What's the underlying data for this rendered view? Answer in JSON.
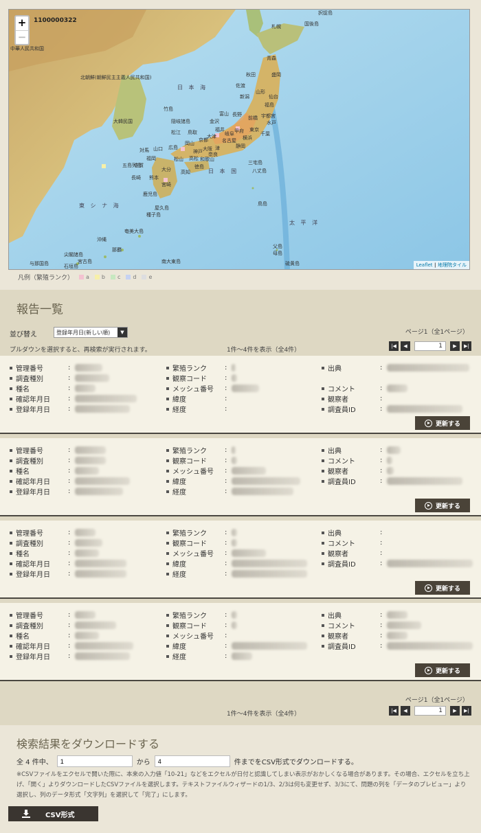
{
  "map": {
    "id_label": "1100000322",
    "zoom_in": "+",
    "zoom_out": "−",
    "labels": {
      "china": "中華人民共和国",
      "north_korea": "北朝鮮(朝鮮民主主義人民共和国)",
      "south_korea": "大韓民国",
      "sea_of_japan": "日 本 海",
      "east_china_sea": "東 シ ナ 海",
      "pacific": "太 平 洋",
      "japan": "日 本 国",
      "sapporo": "札幌",
      "aomori": "青森",
      "akita": "秋田",
      "morioka": "盛岡",
      "sendai": "仙台",
      "yamagata": "山形",
      "niigata": "新潟",
      "fukushima": "福島",
      "kanazawa": "金沢",
      "toyama": "富山",
      "nagano": "長野",
      "maebashi": "前橋",
      "utsunomiya": "宇都宮",
      "mito": "水戸",
      "tokyo": "東京",
      "chiba": "千葉",
      "yokohama": "横浜",
      "kofu": "甲府",
      "shizuoka": "静岡",
      "nagoya": "名古屋",
      "gifu": "岐阜",
      "fukui": "福井",
      "tsu": "津",
      "otsu": "大津",
      "kyoto": "京都",
      "osaka": "大阪",
      "kobe": "神戸",
      "nara": "奈良",
      "wakayama": "和歌山",
      "tottori": "鳥取",
      "matsue": "松江",
      "okayama": "岡山",
      "hiroshima": "広島",
      "yamaguchi": "山口",
      "takamatsu": "高松",
      "tokushima": "徳島",
      "matsuyama": "松山",
      "kochi": "高知",
      "fukuoka": "福岡",
      "saga": "佐賀",
      "nagasaki": "長崎",
      "kumamoto": "熊本",
      "oita": "大分",
      "miyazaki": "宮崎",
      "kagoshima": "鹿児島",
      "naha": "那覇",
      "takeshima": "竹島",
      "oki": "隠岐諸島",
      "tsushima": "対馬",
      "goto": "五島列島",
      "hachijo": "八丈島",
      "miyake": "三宅島",
      "tori": "鳥島",
      "ogasawara": "父島",
      "haha": "母島",
      "amami": "奄美大島",
      "yaku": "屋久島",
      "tanega": "種子島",
      "daito": "南大東島",
      "ishigaki": "石垣島",
      "miyako": "宮古島",
      "yonaguni": "与那国島",
      "sado": "佐渡",
      "etorofu": "択捉島",
      "kunashiri": "国後島",
      "senkaku": "尖閣諸島",
      "okino": "沖縄",
      "io": "硫黄島"
    },
    "attribution_leaflet": "Leaflet",
    "attribution_sep": " | ",
    "attribution_tile": "地理院タイル"
  },
  "legend": {
    "title": "凡例（繁殖ランク）",
    "items": [
      {
        "label": "a",
        "color": "#f4c2d0"
      },
      {
        "label": "b",
        "color": "#f7f0a8"
      },
      {
        "label": "c",
        "color": "#c7e8c0"
      },
      {
        "label": "d",
        "color": "#c6d2f2"
      },
      {
        "label": "e",
        "color": "#dddde0"
      }
    ]
  },
  "report": {
    "title": "報告一覧",
    "sort_label": "並び替え",
    "sort_value": "登録年月日(新しい順)",
    "hint": "プルダウンを選択すると、再検索が実行されます。",
    "count_text": "1件～4件を表示（全4件）",
    "page_info": "ページ1（全1ページ）",
    "page_value": "1",
    "update_label": "更新する",
    "col1_labels": [
      "管理番号",
      "調査種別",
      "種名",
      "確認年月日",
      "登録年月日"
    ],
    "col2_labels": [
      "繁殖ランク",
      "観察コード",
      "メッシュ番号",
      "緯度",
      "経度"
    ],
    "cards": [
      {
        "col3": [
          "出典",
          "",
          "コメント",
          "観察者",
          "調査員ID"
        ],
        "col3_colon": [
          true,
          false,
          true,
          true,
          true
        ]
      },
      {
        "col3": [
          "出典",
          "コメント",
          "観察者",
          "調査員ID"
        ],
        "col3_colon": [
          true,
          true,
          true,
          true
        ]
      },
      {
        "col3": [
          "出典",
          "コメント",
          "観察者",
          "調査員ID"
        ],
        "col3_colon": [
          true,
          true,
          true,
          true
        ]
      },
      {
        "col3": [
          "出典",
          "コメント",
          "観察者",
          "調査員ID"
        ],
        "col3_colon": [
          true,
          true,
          true,
          true
        ]
      }
    ]
  },
  "download": {
    "title": "検索結果をダウンロードする",
    "prefix": "全 4 件中、",
    "from_value": "1",
    "middle": "から",
    "to_value": "4",
    "suffix": "件までをCSV形式でダウンロードする。",
    "note": "※CSVファイルをエクセルで開いた際に、本来の入力値「10-21」などをエクセルが日付と認識してしまい表示がおかしくなる場合があります。その場合、エクセルを立ち上げ、「開く」よりダウンロードしたCSVファイルを選択します。テキストファイルウィザードの1/3、2/3は何も変更せず、3/3にて、問題の列を「データのプレビュー」より選択し、列のデータ形式「文字列」を選択して「完了」にします。",
    "csv_button": "CSV形式"
  }
}
